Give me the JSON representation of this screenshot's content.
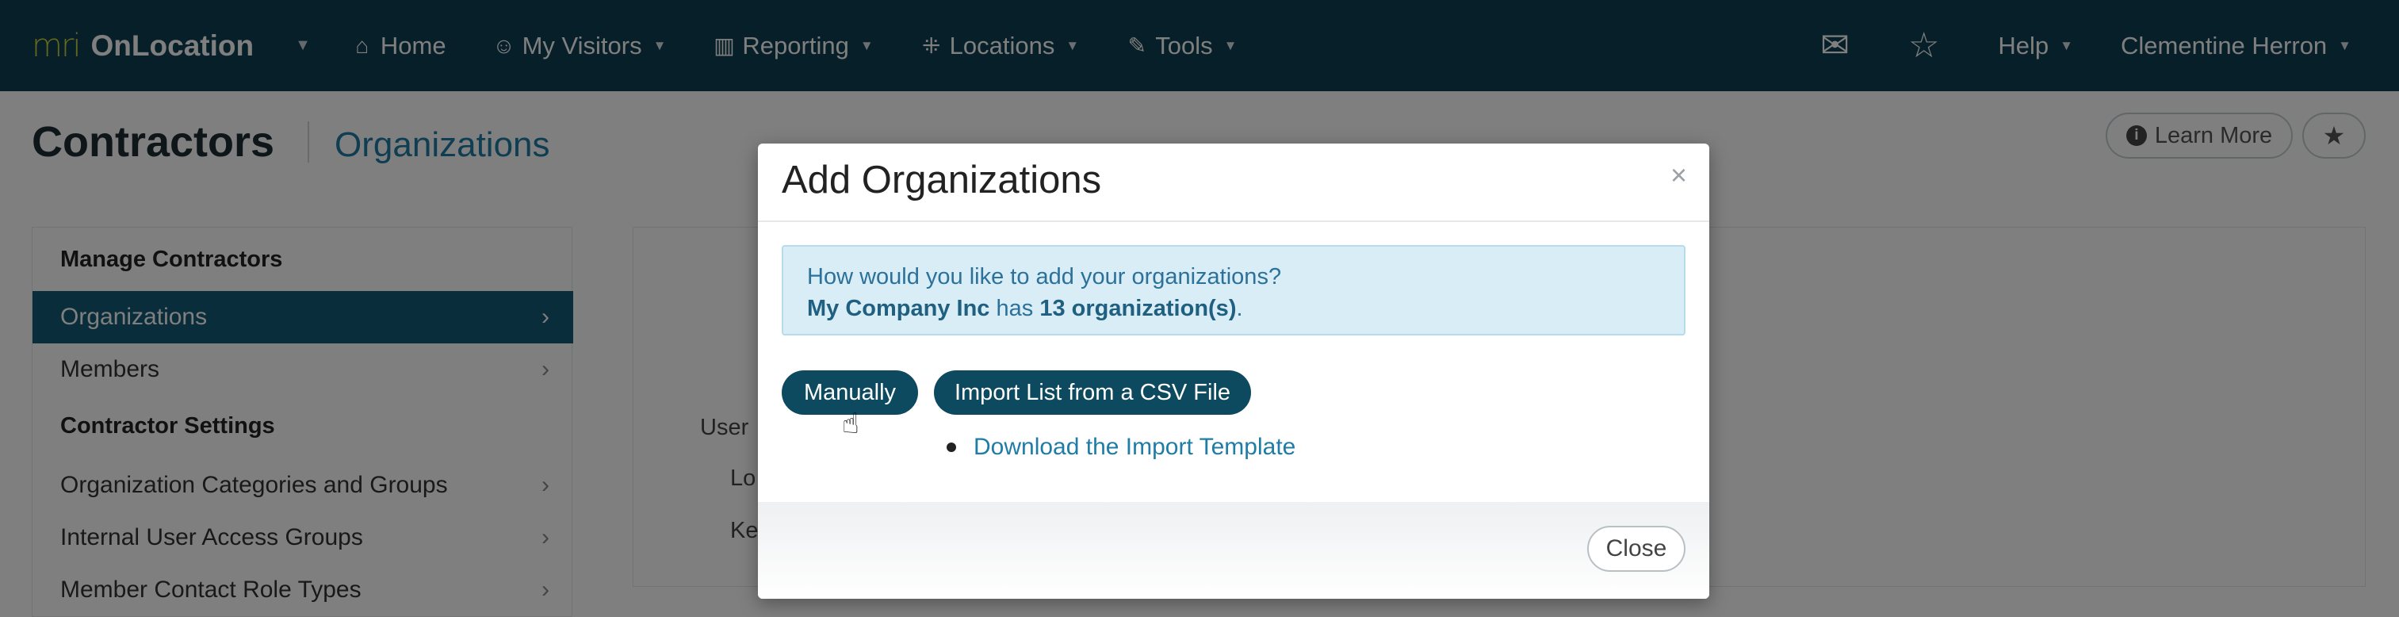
{
  "app": {
    "logo_text": "mri",
    "name": "OnLocation"
  },
  "nav": {
    "items": [
      {
        "icon": "home-icon",
        "glyph": "⌂",
        "label": "Home",
        "has_dropdown": false
      },
      {
        "icon": "person-icon",
        "glyph": "☺",
        "label": "My Visitors",
        "has_dropdown": true
      },
      {
        "icon": "bar-chart-icon",
        "glyph": "▥",
        "label": "Reporting",
        "has_dropdown": true
      },
      {
        "icon": "network-icon",
        "glyph": "⁜",
        "label": "Locations",
        "has_dropdown": true
      },
      {
        "icon": "wrench-icon",
        "glyph": "✎",
        "label": "Tools",
        "has_dropdown": true
      }
    ],
    "right": {
      "help": "Help",
      "user": "Clementine Herron"
    }
  },
  "page": {
    "title": "Contractors",
    "subtitle": "Organizations",
    "learn_more": "Learn More"
  },
  "sidebar": {
    "sections": [
      {
        "heading": "Manage Contractors",
        "items": [
          {
            "label": "Organizations",
            "active": true
          },
          {
            "label": "Members",
            "active": false
          }
        ]
      },
      {
        "heading": "Contractor Settings",
        "items": [
          {
            "label": "Organization Categories and Groups",
            "active": false
          },
          {
            "label": "Internal User Access Groups",
            "active": false
          },
          {
            "label": "Member Contact Role Types",
            "active": false
          }
        ]
      }
    ]
  },
  "main": {
    "partial_labels": [
      "User",
      "Lo",
      "Ke"
    ]
  },
  "modal": {
    "title": "Add Organizations",
    "close_x": "×",
    "alert": {
      "question": "How would you like to add your organizations?",
      "company": "My Company Inc",
      "has": "has",
      "count": "13 organization(s)",
      "period": "."
    },
    "manually_button": "Manually",
    "import_button": "Import List from a CSV File",
    "template_link": "Download the Import Template",
    "close_button": "Close"
  },
  "colors": {
    "nav_bg": "#0d3f50",
    "accent": "#1e7ca6",
    "active_item": "#155a76",
    "button": "#0d4a5f",
    "alert_bg": "#d9edf7"
  }
}
